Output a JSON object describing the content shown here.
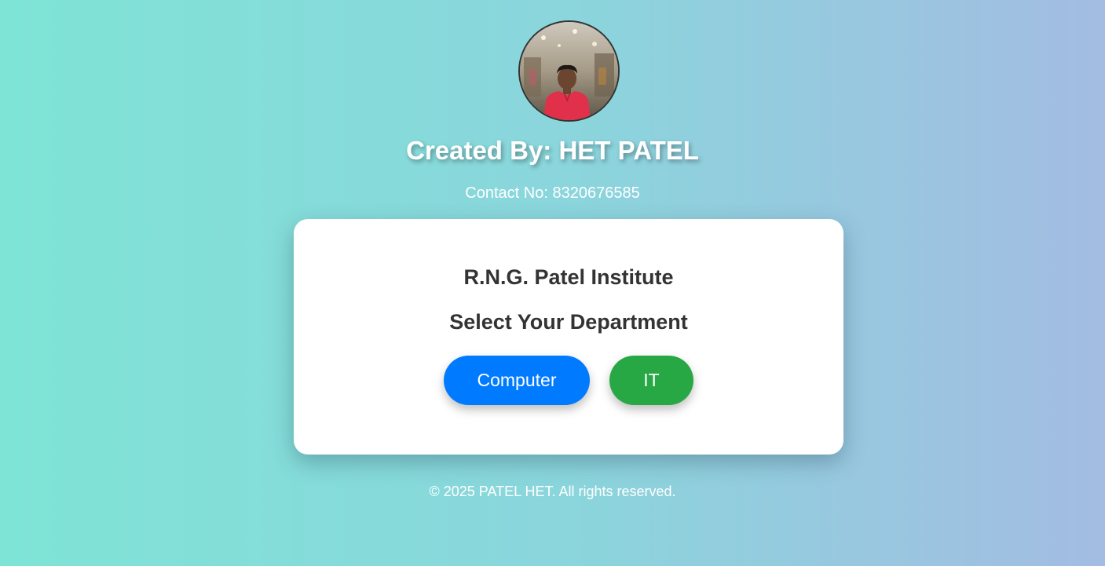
{
  "header": {
    "avatar_icon": "profile-photo",
    "creator_title": "Created By: HET PATEL",
    "contact": "Contact No: 8320676585"
  },
  "card": {
    "institute": "R.N.G. Patel Institute",
    "heading": "Select Your Department",
    "buttons": [
      {
        "label": "Computer",
        "color": "#007bff"
      },
      {
        "label": "IT",
        "color": "#28a745"
      }
    ]
  },
  "footer": {
    "copyright": "© 2025 PATEL HET. All rights reserved."
  },
  "colors": {
    "gradient_start": "#7ee4d6",
    "gradient_end": "#a3bce2",
    "card_bg": "#ffffff",
    "heading_text": "#333333"
  }
}
